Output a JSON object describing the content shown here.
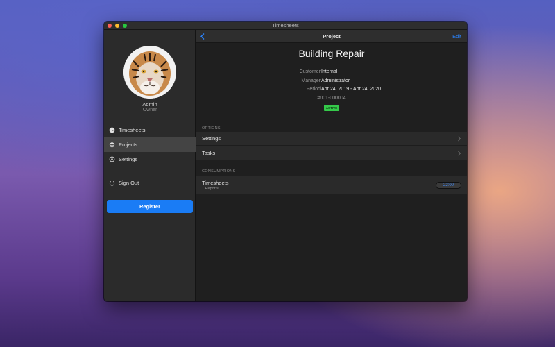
{
  "window": {
    "title": "Timesheets"
  },
  "profile": {
    "name": "Admin",
    "role": "Owner"
  },
  "sidebar": {
    "items": [
      {
        "label": "Timesheets",
        "icon": "clock-icon",
        "selected": false
      },
      {
        "label": "Projects",
        "icon": "layers-icon",
        "selected": true
      },
      {
        "label": "Settings",
        "icon": "gear-icon",
        "selected": false
      },
      {
        "label": "Sign Out",
        "icon": "power-icon",
        "selected": false
      }
    ],
    "register_label": "Register"
  },
  "navbar": {
    "title": "Project",
    "edit_label": "Edit",
    "back_icon": "chevron-left-icon"
  },
  "project": {
    "name": "Building Repair",
    "customer_label": "Customer",
    "customer": "Internal",
    "manager_label": "Manager",
    "manager": "Administrator",
    "period_label": "Period",
    "period": "Apr 24, 2019 - Apr 24, 2020",
    "code": "#001-000004",
    "status": "ACTIVE"
  },
  "options": {
    "header": "OPTIONS",
    "rows": [
      {
        "label": "Settings"
      },
      {
        "label": "Tasks"
      }
    ]
  },
  "consumptions": {
    "header": "CONSUMPTIONS",
    "rows": [
      {
        "title": "Timesheets",
        "subtitle": "1 Reports",
        "value": "22:00"
      }
    ]
  },
  "colors": {
    "accent": "#1a7cf5",
    "link": "#2a84ff",
    "status_active": "#35c94a"
  }
}
